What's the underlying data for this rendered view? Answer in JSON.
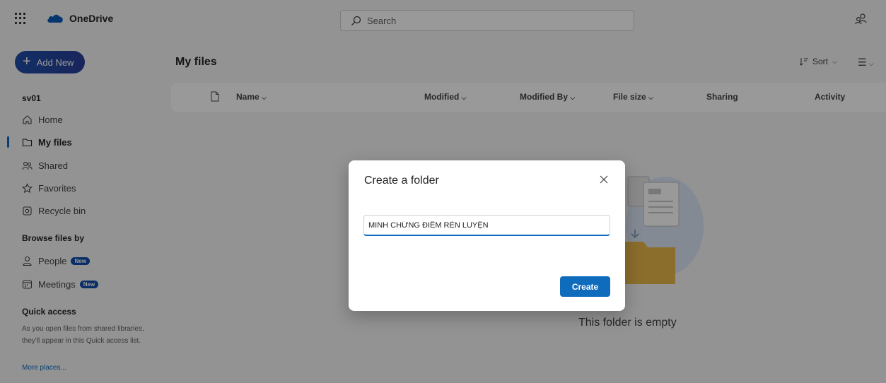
{
  "app": {
    "brand": "OneDrive"
  },
  "search": {
    "placeholder": "Search"
  },
  "sidebar": {
    "add_new": "Add New",
    "account": "sv01",
    "items": [
      {
        "label": "Home",
        "icon": "home-icon"
      },
      {
        "label": "My files",
        "icon": "folder-icon",
        "active": true
      },
      {
        "label": "Shared",
        "icon": "shared-icon"
      },
      {
        "label": "Favorites",
        "icon": "star-icon"
      },
      {
        "label": "Recycle bin",
        "icon": "recycle-bin-icon"
      }
    ],
    "browse_heading": "Browse files by",
    "browse": [
      {
        "label": "People",
        "badge": "New",
        "icon": "person-icon"
      },
      {
        "label": "Meetings",
        "badge": "New",
        "icon": "calendar-icon"
      }
    ],
    "quick_access": {
      "heading": "Quick access",
      "description": "As you open files from shared libraries, they'll appear in this Quick access list.",
      "more": "More places..."
    }
  },
  "main": {
    "title": "My files",
    "sort_label": "Sort",
    "columns": [
      "Name",
      "Modified",
      "Modified By",
      "File size",
      "Sharing",
      "Activity"
    ],
    "empty_text": "This folder is empty"
  },
  "dialog": {
    "title": "Create a folder",
    "input_value": "MINH CHỨNG ĐIỂM RÈN LUYỆN",
    "create_label": "Create"
  },
  "colors": {
    "accent": "#0f6cbd",
    "add_new": "#1e4fa8",
    "badge": "#0f4ea8"
  }
}
